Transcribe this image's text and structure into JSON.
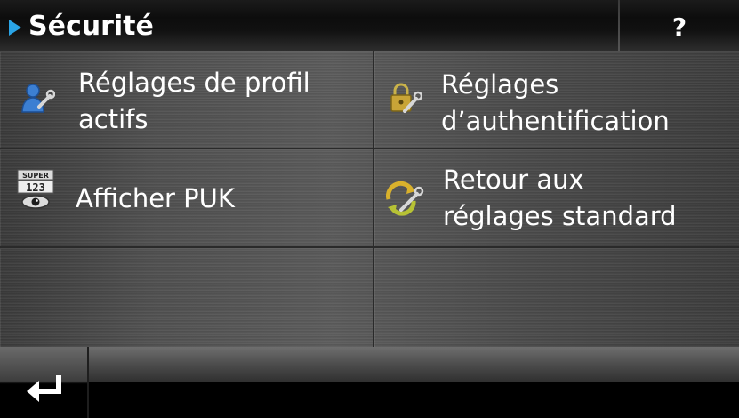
{
  "header": {
    "title": "Sécurité",
    "help_label": "?"
  },
  "menu": {
    "profile_settings": {
      "line1": "Réglages de profil",
      "line2": "actifs",
      "icon": "user-wrench-icon"
    },
    "auth_settings": {
      "line1": "Réglages",
      "line2": "d’authentification",
      "icon": "lock-wrench-icon"
    },
    "show_puk": {
      "label": "Afficher PUK",
      "icon_text_top": "SUPER",
      "icon_text_bottom": "123",
      "icon": "puk-code-icon"
    },
    "reset_defaults": {
      "line1": "Retour aux",
      "line2": "réglages standard",
      "icon": "reset-wrench-icon"
    }
  },
  "footer": {
    "back_icon": "back-arrow-icon"
  },
  "colors": {
    "accent": "#2aa4e6",
    "text": "#ffffff"
  }
}
